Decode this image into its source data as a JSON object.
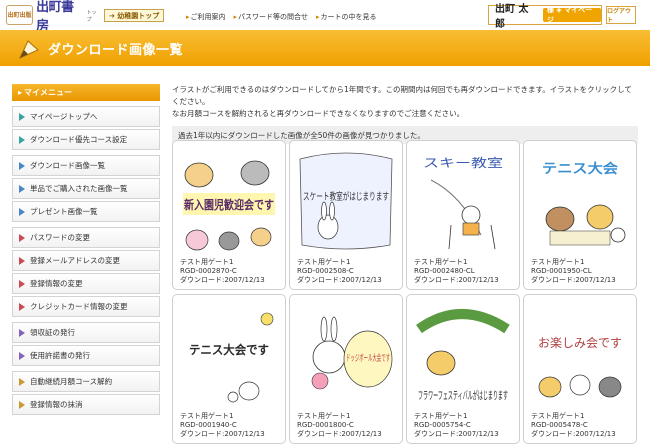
{
  "header": {
    "logo_mark": "出町出版",
    "logo_text": "出町書房",
    "logo_sub": "トップ",
    "kinder_label": "➔ 幼稚園トップ",
    "links": [
      "ご利用案内",
      "パスワード等の問合せ",
      "カートの中を見る"
    ],
    "user_name": "出町 太郎",
    "mypage_label": "様 ◈ マイページ",
    "logout_label": "ログアウト"
  },
  "banner": {
    "title": "ダウンロード画像一覧"
  },
  "sidebar": {
    "header": "マイメニュー",
    "groups": [
      [
        {
          "label": "マイページトップへ",
          "color": "teal"
        },
        {
          "label": "ダウンロード優先コース設定",
          "color": "teal"
        }
      ],
      [
        {
          "label": "ダウンロード画像一覧",
          "color": "blue"
        },
        {
          "label": "単品でご購入された画像一覧",
          "color": "blue"
        },
        {
          "label": "プレゼント画像一覧",
          "color": "blue"
        }
      ],
      [
        {
          "label": "パスワードの変更",
          "color": "red"
        },
        {
          "label": "登録メールアドレスの変更",
          "color": "red"
        },
        {
          "label": "登録情報の変更",
          "color": "red"
        },
        {
          "label": "クレジットカード情報の変更",
          "color": "red"
        }
      ],
      [
        {
          "label": "領収証の発行",
          "color": "purple"
        },
        {
          "label": "使用許諾書の発行",
          "color": "purple"
        }
      ],
      [
        {
          "label": "自動継続月額コース解約",
          "color": "gold"
        },
        {
          "label": "登録情報の抹消",
          "color": "gold"
        }
      ]
    ]
  },
  "main": {
    "intro_1": "イラストがご利用できるのはダウンロードしてから1年間です。この期間内は何回でも再ダウンロードできます。イラストをクリックしてください。",
    "intro_2": "なお月額コースを解約されると再ダウンロードできなくなりますのでご注意ください。",
    "result_text": "過去1年以内にダウンロードした画像が全50件の画像が見つかりました。"
  },
  "cards": [
    {
      "name": "テスト用ゲート1",
      "code": "RGD-0002870-C",
      "download": "ダウンロード:2007/12/13",
      "art": "新入園児歓迎会です"
    },
    {
      "name": "テスト用ゲート1",
      "code": "RGD-0002508-C",
      "download": "ダウンロード:2007/12/13",
      "art": "スケート教室がはじまります"
    },
    {
      "name": "テスト用ゲート1",
      "code": "RGD-0002480-CL",
      "download": "ダウンロード:2007/12/13",
      "art": "スキー教室"
    },
    {
      "name": "テスト用ゲート1",
      "code": "RGD-0001950-CL",
      "download": "ダウンロード:2007/12/13",
      "art": "テニス大会"
    },
    {
      "name": "テスト用ゲート1",
      "code": "RGD-0001940-C",
      "download": "ダウンロード:2007/12/13",
      "art": "テニス大会です"
    },
    {
      "name": "テスト用ゲート1",
      "code": "RGD-0001800-C",
      "download": "ダウンロード:2007/12/13",
      "art": "ドッジボール大会です"
    },
    {
      "name": "テスト用ゲート1",
      "code": "RGD-0005754-C",
      "download": "ダウンロード:2007/12/13",
      "art": "フラワーフェスティバルがはじまります"
    },
    {
      "name": "テスト用ゲート1",
      "code": "RGD-0005478-C",
      "download": "ダウンロード:2007/12/13",
      "art": "お楽しみ会です"
    }
  ]
}
